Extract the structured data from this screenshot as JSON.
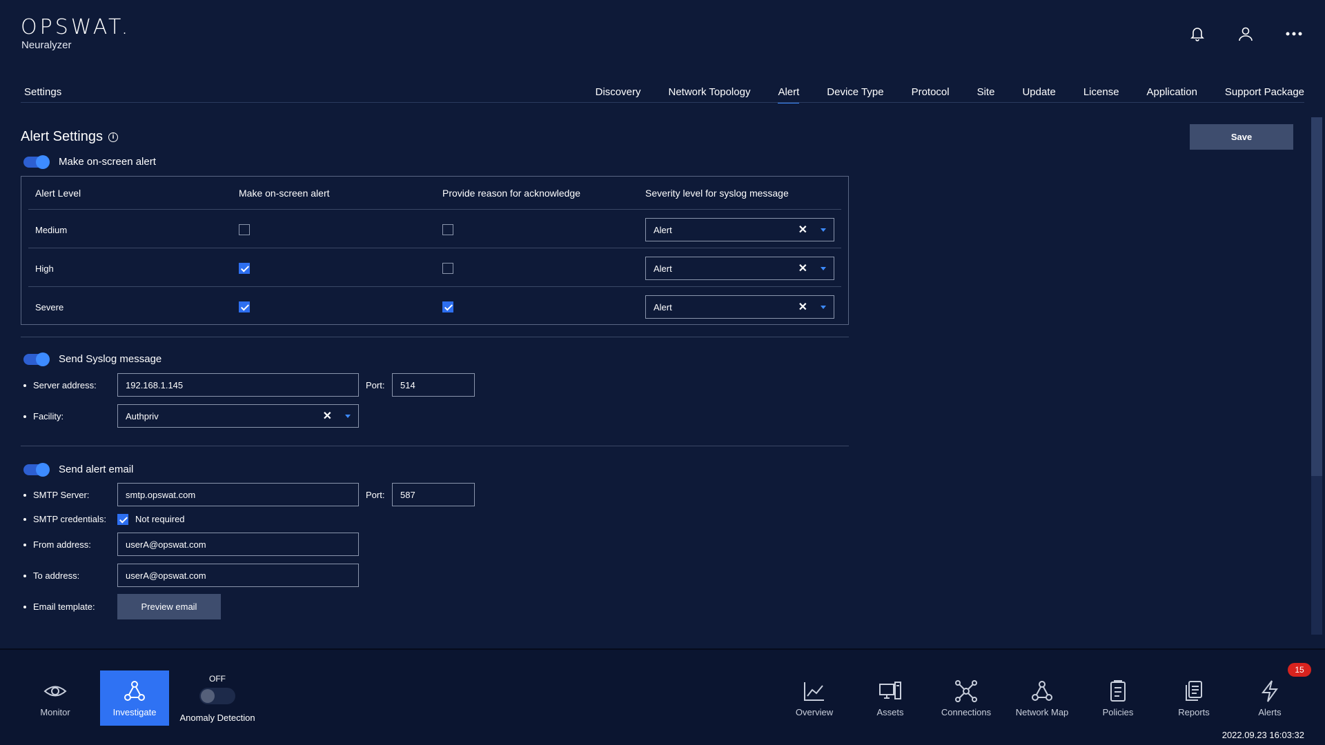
{
  "app": {
    "logo": "OPSWAT.",
    "product": "Neuralyzer"
  },
  "header_icons": [
    "bell-icon",
    "user-icon",
    "more-icon"
  ],
  "settings_label": "Settings",
  "tabs": [
    "Discovery",
    "Network Topology",
    "Alert",
    "Device Type",
    "Protocol",
    "Site",
    "Update",
    "License",
    "Application",
    "Support Package"
  ],
  "active_tab": "Alert",
  "page_title": "Alert Settings",
  "save_label": "Save",
  "onscreen": {
    "toggle_label": "Make on-screen alert",
    "toggle_on": true,
    "headers": [
      "Alert Level",
      "Make on-screen alert",
      "Provide reason for acknowledge",
      "Severity level for syslog message"
    ],
    "rows": [
      {
        "level": "Medium",
        "onscreen": false,
        "reason": false,
        "severity": "Alert"
      },
      {
        "level": "High",
        "onscreen": true,
        "reason": false,
        "severity": "Alert"
      },
      {
        "level": "Severe",
        "onscreen": true,
        "reason": true,
        "severity": "Alert"
      }
    ]
  },
  "syslog": {
    "toggle_label": "Send Syslog message",
    "toggle_on": true,
    "server_label": "Server address:",
    "server_value": "192.168.1.145",
    "port_label": "Port:",
    "port_value": "514",
    "facility_label": "Facility:",
    "facility_value": "Authpriv"
  },
  "email": {
    "toggle_label": "Send alert email",
    "toggle_on": true,
    "smtp_label": "SMTP Server:",
    "smtp_value": "smtp.opswat.com",
    "port_label": "Port:",
    "port_value": "587",
    "cred_label": "SMTP credentials:",
    "cred_checked": true,
    "cred_text": "Not required",
    "from_label": "From address:",
    "from_value": "userA@opswat.com",
    "to_label": "To address:",
    "to_value": "userA@opswat.com",
    "template_label": "Email template:",
    "preview_label": "Preview email"
  },
  "bottom_nav": {
    "left": [
      {
        "label": "Monitor",
        "icon": "eye-icon",
        "active": false
      },
      {
        "label": "Investigate",
        "icon": "investigate-icon",
        "active": true
      }
    ],
    "anomaly": {
      "state": "OFF",
      "label": "Anomaly Detection"
    },
    "right": [
      {
        "label": "Overview",
        "icon": "chart-line-icon"
      },
      {
        "label": "Assets",
        "icon": "assets-icon"
      },
      {
        "label": "Connections",
        "icon": "connections-icon"
      },
      {
        "label": "Network Map",
        "icon": "network-map-icon"
      },
      {
        "label": "Policies",
        "icon": "clipboard-icon"
      },
      {
        "label": "Reports",
        "icon": "reports-icon"
      },
      {
        "label": "Alerts",
        "icon": "bolt-icon"
      }
    ],
    "alerts_badge": "15"
  },
  "timestamp": "2022.09.23 16:03:32",
  "colors": {
    "background": "#0e1a38",
    "accent": "#2f72f3",
    "badge": "#d7231e"
  }
}
